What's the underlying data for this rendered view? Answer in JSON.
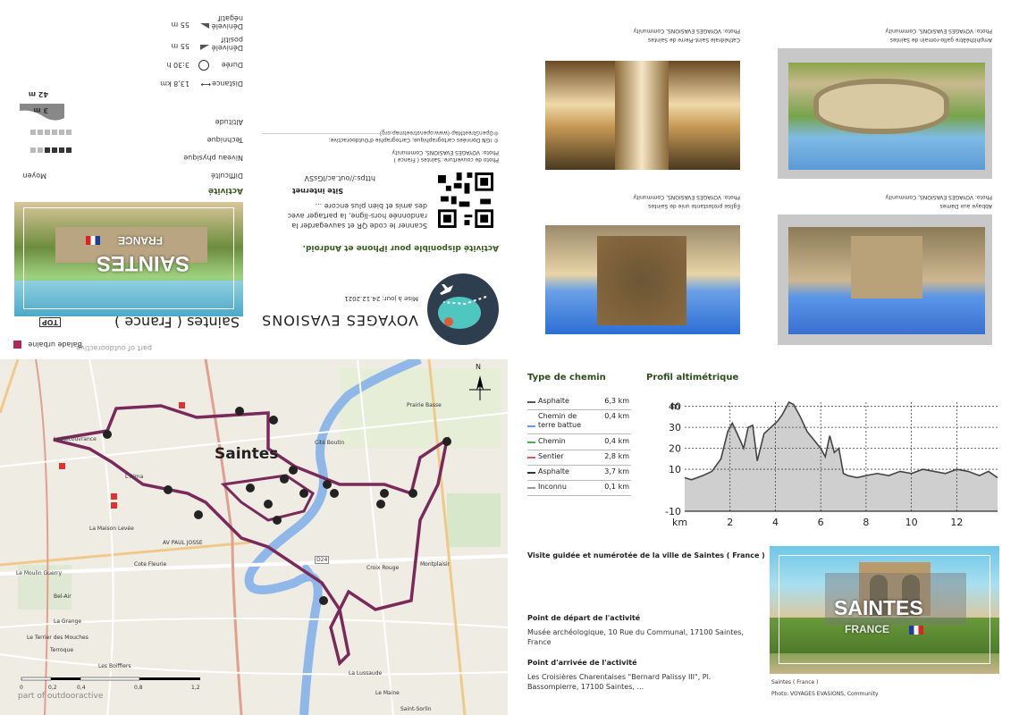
{
  "cover": {
    "category_label": "Balade urbaine",
    "top_badge": "TOP",
    "title": "Saintes ( France )",
    "author": "VOYAGES EVASIONS",
    "update": "Mise à jour: 24.12.2021",
    "banner_city": "SAINTES",
    "banner_country": "FRANCE",
    "app_text": "Activité disponible pour iPhone et Android.",
    "scan_text_1": "Scanner le code QR et sauvegarder la",
    "scan_text_2": "randonnée hors-ligne, la partager avec",
    "scan_text_3": "des amis et bien plus encore ...",
    "site_label": "Site internet",
    "site_url": "https://out.ac/lGsSV",
    "cover_photo_credit_1": "Photo de couverture: Saintes ( France )",
    "cover_photo_credit_2": "Photo: VOYAGES EVASIONS, Community",
    "map_credit_1": "© IGN Données cartographique; Cartographie d'Outdooractive;",
    "map_credit_2": "©OpenStreetMap (www.openstreetmap.org)",
    "part_of": "part of outdooractive"
  },
  "activity": {
    "heading": "Activité",
    "difficulty_label": "Difficulté",
    "difficulty_value": "Moyen",
    "distance_label": "Distance",
    "distance_value": "13,8 km",
    "fitness_label": "Niveau physique",
    "duration_label": "Durée",
    "duration_value": "3:30 h",
    "technique_label": "Technique",
    "ascent_label": "Dénivelé positif",
    "ascent_value": "55 m",
    "altitude_label": "Altitude",
    "altitude_max": "42 m",
    "altitude_min": "3 m",
    "descent_label": "Dénivelé négatif",
    "descent_value": "55 m",
    "fitness_level": 4,
    "technique_level": 0
  },
  "photos": [
    {
      "caption": "Cathédrale Saint-Pierre de Saintes",
      "credit": "Photo: VOYAGES EVASIONS, Community"
    },
    {
      "caption": "Amphithéâtre gallo-romain de Saintes",
      "credit": "Photo: VOYAGES EVASIONS, Community"
    },
    {
      "caption": "Église protestante unie de Saintes",
      "credit": "Photo: VOYAGES EVASIONS, Community"
    },
    {
      "caption": "Abbaye aux Dames",
      "credit": "Photo: VOYAGES EVASIONS, Community"
    }
  ],
  "map": {
    "city_label": "Saintes",
    "labels": [
      "La Recouvrance",
      "Prairie Basse",
      "Cité Boutin",
      "L'Alma",
      "Le Moulin Guerry",
      "Croix Rouge",
      "La Maison Levée",
      "Cote Fleurie",
      "Bel-Air",
      "La Grange",
      "Le Terrier des Mouches",
      "Terroque",
      "Les Boiffiers",
      "La Lussaude",
      "Montplaisir",
      "Le Maine",
      "Saint-Sorlin",
      "AV PAUL JOSSE",
      "D24"
    ],
    "north": "N",
    "scale_ticks": [
      "0",
      "0,2",
      "0,4",
      "0,8",
      "1,2"
    ],
    "footer": "part of outdooractive"
  },
  "surface": {
    "title": "Type de chemin",
    "rows": [
      {
        "label": "Asphalte",
        "value": "6,3 km",
        "color": "#555555"
      },
      {
        "label": "Chemin de terre battue",
        "value": "0,4 km",
        "color": "#6aa0d8"
      },
      {
        "label": "Chemin",
        "value": "0,4 km",
        "color": "#4caf50"
      },
      {
        "label": "Sentier",
        "value": "2,8 km",
        "color": "#e05a5a"
      },
      {
        "label": "Asphalte",
        "value": "3,7 km",
        "color": "#333333"
      },
      {
        "label": "Inconnu",
        "value": "0,1 km",
        "color": "#999999"
      }
    ]
  },
  "chart_data": {
    "type": "area",
    "title": "Profil altimétrique",
    "xlabel": "km",
    "ylabel": "m",
    "x_ticks": [
      2,
      4,
      6,
      8,
      10,
      12
    ],
    "y_ticks": [
      -10,
      10,
      20,
      30,
      40
    ],
    "xlim": [
      0,
      13.8
    ],
    "ylim": [
      -10,
      42
    ],
    "x": [
      0,
      0.3,
      0.8,
      1.2,
      1.6,
      1.9,
      2.1,
      2.4,
      2.6,
      2.8,
      3.0,
      3.2,
      3.5,
      3.8,
      4.1,
      4.3,
      4.6,
      4.8,
      5.1,
      5.4,
      5.7,
      6.0,
      6.2,
      6.4,
      6.6,
      6.8,
      7.0,
      7.2,
      7.6,
      8.0,
      8.5,
      9.0,
      9.5,
      10.0,
      10.5,
      11.0,
      11.5,
      12.0,
      12.5,
      13.0,
      13.4,
      13.8
    ],
    "y": [
      6,
      5,
      7,
      9,
      15,
      28,
      32,
      25,
      20,
      30,
      31,
      14,
      27,
      30,
      33,
      36,
      42,
      41,
      35,
      28,
      24,
      20,
      16,
      26,
      18,
      20,
      8,
      7,
      6,
      7,
      8,
      7,
      9,
      8,
      10,
      9,
      8,
      10,
      9,
      7,
      9,
      6
    ],
    "colors": {
      "fill": "#cfcfcf",
      "line": "#444444",
      "grid": "#444444"
    }
  },
  "guide": {
    "title": "Visite guidée et numérotée de la ville de Saintes ( France )",
    "start_label": "Point de départ de l'activité",
    "start_value": "Musée archéologique, 10 Rue du Communal, 17100 Saintes, France",
    "end_label": "Point d'arrivée de l'activité",
    "end_value": "Les Croisières Charentaises \"Bernard Palissy III\", Pl. Bassompierre, 17100 Saintes, ...",
    "banner_city": "SAINTES",
    "banner_country": "FRANCE",
    "photo_caption": "Saintes ( France )",
    "photo_credit": "Photo: VOYAGES EVASIONS, Community"
  },
  "colors": {
    "route": "#7a2a5a",
    "river": "#8fb8e8",
    "heading_green": "#2e4b1f",
    "accent_red": "#c0303a"
  }
}
